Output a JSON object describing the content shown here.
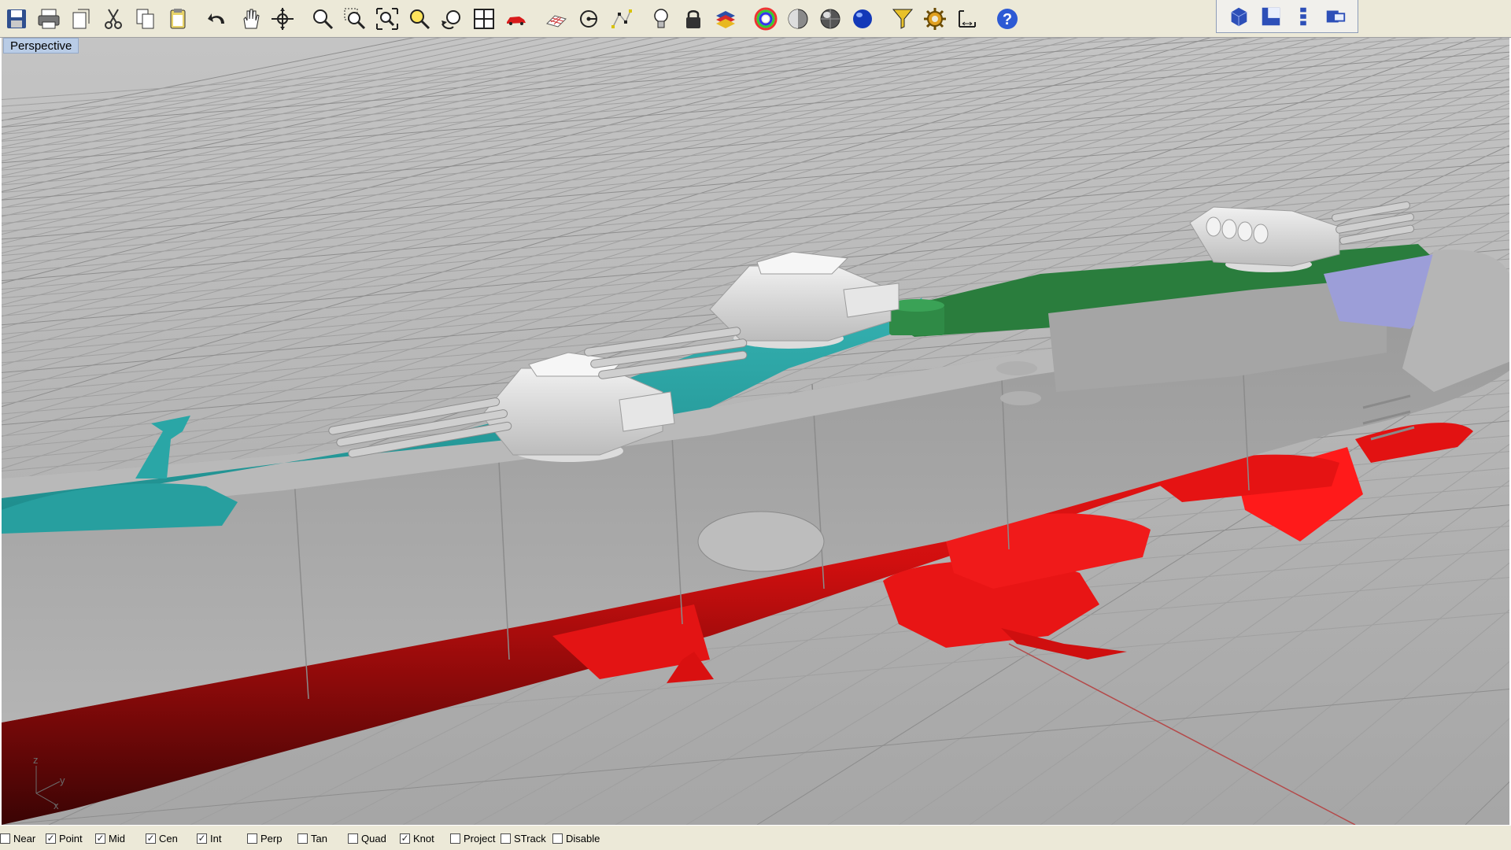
{
  "toolbar": {
    "buttons": [
      {
        "icon": "save-icon"
      },
      {
        "icon": "print-icon"
      },
      {
        "icon": "copy-to-clipboard-icon"
      },
      {
        "icon": "cut-icon"
      },
      {
        "icon": "copy-icon"
      },
      {
        "icon": "paste-icon"
      },
      {
        "icon": "undo-icon"
      },
      {
        "icon": "pan-hand-icon"
      },
      {
        "icon": "rotate-view-icon"
      },
      {
        "icon": "zoom-icon"
      },
      {
        "icon": "zoom-window-icon"
      },
      {
        "icon": "zoom-extents-icon"
      },
      {
        "icon": "zoom-selected-icon"
      },
      {
        "icon": "undo-view-icon"
      },
      {
        "icon": "four-viewports-icon"
      },
      {
        "icon": "car-model-icon"
      },
      {
        "icon": "grid-plane-icon"
      },
      {
        "icon": "select-point-icon"
      },
      {
        "icon": "points-icon"
      },
      {
        "icon": "lightbulb-icon"
      },
      {
        "icon": "lock-icon"
      },
      {
        "icon": "layers-icon"
      },
      {
        "icon": "color-wheel-icon"
      },
      {
        "icon": "shaded-sphere-icon"
      },
      {
        "icon": "rendered-sphere-icon"
      },
      {
        "icon": "blue-sphere-icon"
      },
      {
        "icon": "select-filter-icon"
      },
      {
        "icon": "options-gear-icon"
      },
      {
        "icon": "dimensions-icon"
      },
      {
        "icon": "help-icon"
      }
    ]
  },
  "viewport_tools": [
    {
      "icon": "cube-view-icon"
    },
    {
      "icon": "front-view-icon"
    },
    {
      "icon": "vertical-split-icon"
    },
    {
      "icon": "horizontal-split-icon"
    }
  ],
  "viewport": {
    "title": "Perspective",
    "axes": {
      "z": "z",
      "y": "y",
      "x": "x"
    }
  },
  "colors": {
    "hull_gray": "#a4a4a4",
    "hull_red": "#e41010",
    "deck_teal": "#2aa6a6",
    "deck_green": "#2a7d3d",
    "window_purple": "#9c9ed8",
    "grid_bg": "#a9a9a9"
  },
  "osnaps": [
    {
      "label": "Near",
      "checked": false
    },
    {
      "label": "Point",
      "checked": true
    },
    {
      "label": "Mid",
      "checked": true
    },
    {
      "label": "Cen",
      "checked": true
    },
    {
      "label": "Int",
      "checked": true
    },
    {
      "label": "Perp",
      "checked": false
    },
    {
      "label": "Tan",
      "checked": false
    },
    {
      "label": "Quad",
      "checked": false
    },
    {
      "label": "Knot",
      "checked": true
    },
    {
      "label": "Project",
      "checked": false
    },
    {
      "label": "STrack",
      "checked": false
    },
    {
      "label": "Disable",
      "checked": false
    }
  ]
}
